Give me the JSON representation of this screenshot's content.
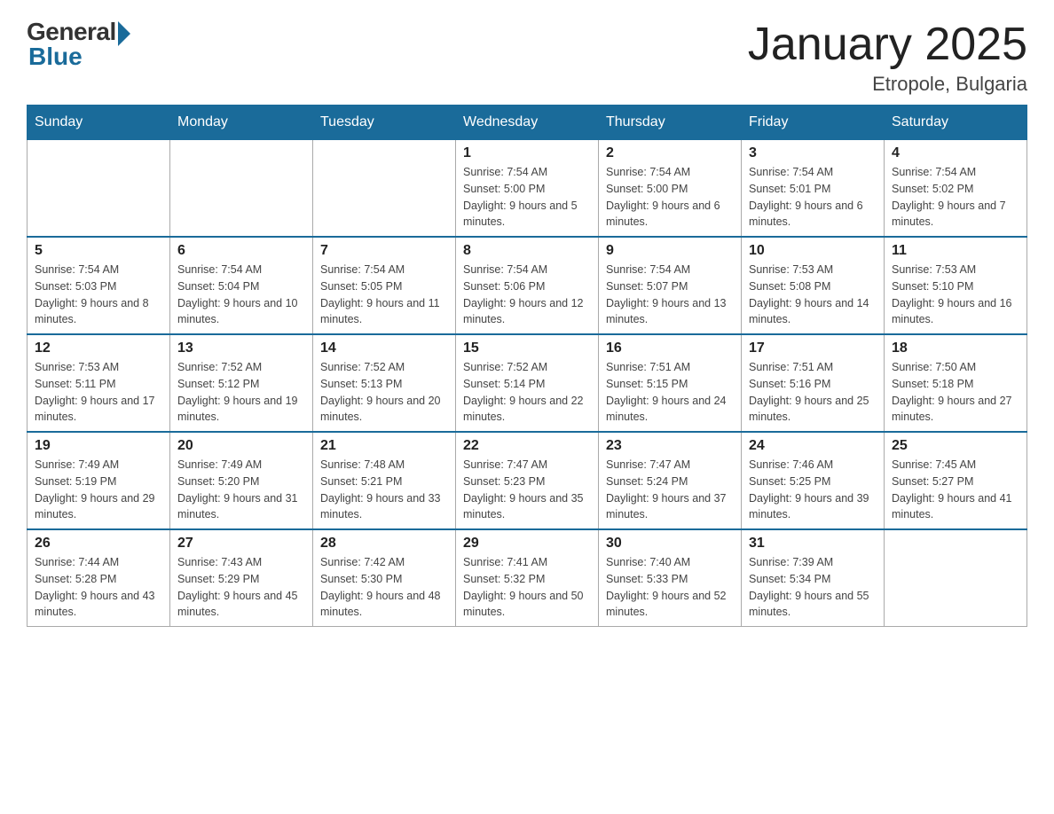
{
  "logo": {
    "general": "General",
    "blue": "Blue"
  },
  "title": "January 2025",
  "location": "Etropole, Bulgaria",
  "days_of_week": [
    "Sunday",
    "Monday",
    "Tuesday",
    "Wednesday",
    "Thursday",
    "Friday",
    "Saturday"
  ],
  "weeks": [
    [
      {
        "day": "",
        "info": ""
      },
      {
        "day": "",
        "info": ""
      },
      {
        "day": "",
        "info": ""
      },
      {
        "day": "1",
        "info": "Sunrise: 7:54 AM\nSunset: 5:00 PM\nDaylight: 9 hours and 5 minutes."
      },
      {
        "day": "2",
        "info": "Sunrise: 7:54 AM\nSunset: 5:00 PM\nDaylight: 9 hours and 6 minutes."
      },
      {
        "day": "3",
        "info": "Sunrise: 7:54 AM\nSunset: 5:01 PM\nDaylight: 9 hours and 6 minutes."
      },
      {
        "day": "4",
        "info": "Sunrise: 7:54 AM\nSunset: 5:02 PM\nDaylight: 9 hours and 7 minutes."
      }
    ],
    [
      {
        "day": "5",
        "info": "Sunrise: 7:54 AM\nSunset: 5:03 PM\nDaylight: 9 hours and 8 minutes."
      },
      {
        "day": "6",
        "info": "Sunrise: 7:54 AM\nSunset: 5:04 PM\nDaylight: 9 hours and 10 minutes."
      },
      {
        "day": "7",
        "info": "Sunrise: 7:54 AM\nSunset: 5:05 PM\nDaylight: 9 hours and 11 minutes."
      },
      {
        "day": "8",
        "info": "Sunrise: 7:54 AM\nSunset: 5:06 PM\nDaylight: 9 hours and 12 minutes."
      },
      {
        "day": "9",
        "info": "Sunrise: 7:54 AM\nSunset: 5:07 PM\nDaylight: 9 hours and 13 minutes."
      },
      {
        "day": "10",
        "info": "Sunrise: 7:53 AM\nSunset: 5:08 PM\nDaylight: 9 hours and 14 minutes."
      },
      {
        "day": "11",
        "info": "Sunrise: 7:53 AM\nSunset: 5:10 PM\nDaylight: 9 hours and 16 minutes."
      }
    ],
    [
      {
        "day": "12",
        "info": "Sunrise: 7:53 AM\nSunset: 5:11 PM\nDaylight: 9 hours and 17 minutes."
      },
      {
        "day": "13",
        "info": "Sunrise: 7:52 AM\nSunset: 5:12 PM\nDaylight: 9 hours and 19 minutes."
      },
      {
        "day": "14",
        "info": "Sunrise: 7:52 AM\nSunset: 5:13 PM\nDaylight: 9 hours and 20 minutes."
      },
      {
        "day": "15",
        "info": "Sunrise: 7:52 AM\nSunset: 5:14 PM\nDaylight: 9 hours and 22 minutes."
      },
      {
        "day": "16",
        "info": "Sunrise: 7:51 AM\nSunset: 5:15 PM\nDaylight: 9 hours and 24 minutes."
      },
      {
        "day": "17",
        "info": "Sunrise: 7:51 AM\nSunset: 5:16 PM\nDaylight: 9 hours and 25 minutes."
      },
      {
        "day": "18",
        "info": "Sunrise: 7:50 AM\nSunset: 5:18 PM\nDaylight: 9 hours and 27 minutes."
      }
    ],
    [
      {
        "day": "19",
        "info": "Sunrise: 7:49 AM\nSunset: 5:19 PM\nDaylight: 9 hours and 29 minutes."
      },
      {
        "day": "20",
        "info": "Sunrise: 7:49 AM\nSunset: 5:20 PM\nDaylight: 9 hours and 31 minutes."
      },
      {
        "day": "21",
        "info": "Sunrise: 7:48 AM\nSunset: 5:21 PM\nDaylight: 9 hours and 33 minutes."
      },
      {
        "day": "22",
        "info": "Sunrise: 7:47 AM\nSunset: 5:23 PM\nDaylight: 9 hours and 35 minutes."
      },
      {
        "day": "23",
        "info": "Sunrise: 7:47 AM\nSunset: 5:24 PM\nDaylight: 9 hours and 37 minutes."
      },
      {
        "day": "24",
        "info": "Sunrise: 7:46 AM\nSunset: 5:25 PM\nDaylight: 9 hours and 39 minutes."
      },
      {
        "day": "25",
        "info": "Sunrise: 7:45 AM\nSunset: 5:27 PM\nDaylight: 9 hours and 41 minutes."
      }
    ],
    [
      {
        "day": "26",
        "info": "Sunrise: 7:44 AM\nSunset: 5:28 PM\nDaylight: 9 hours and 43 minutes."
      },
      {
        "day": "27",
        "info": "Sunrise: 7:43 AM\nSunset: 5:29 PM\nDaylight: 9 hours and 45 minutes."
      },
      {
        "day": "28",
        "info": "Sunrise: 7:42 AM\nSunset: 5:30 PM\nDaylight: 9 hours and 48 minutes."
      },
      {
        "day": "29",
        "info": "Sunrise: 7:41 AM\nSunset: 5:32 PM\nDaylight: 9 hours and 50 minutes."
      },
      {
        "day": "30",
        "info": "Sunrise: 7:40 AM\nSunset: 5:33 PM\nDaylight: 9 hours and 52 minutes."
      },
      {
        "day": "31",
        "info": "Sunrise: 7:39 AM\nSunset: 5:34 PM\nDaylight: 9 hours and 55 minutes."
      },
      {
        "day": "",
        "info": ""
      }
    ]
  ]
}
